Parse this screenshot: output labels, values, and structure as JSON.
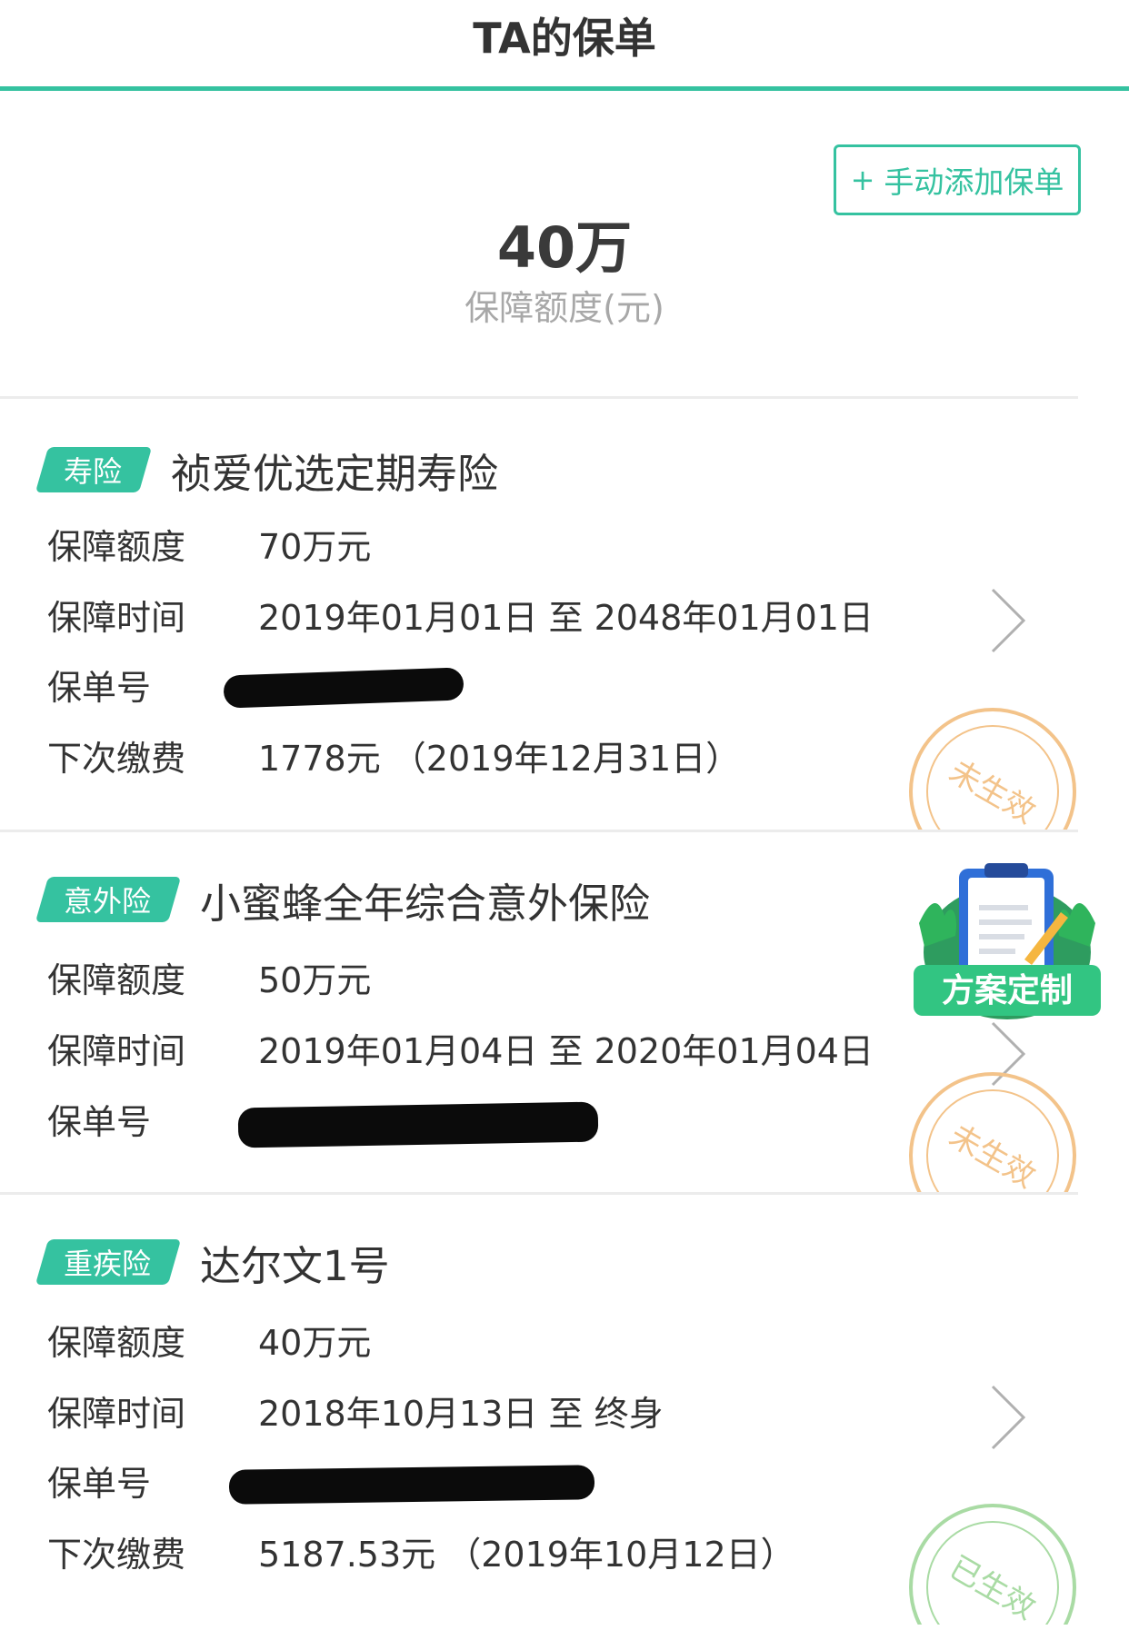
{
  "header": {
    "title": "TA的保单"
  },
  "add_button": {
    "plus": "+",
    "label": "手动添加保单"
  },
  "summary": {
    "amount": "40万",
    "label": "保障额度(元)"
  },
  "labels": {
    "coverage": "保障额度",
    "period": "保障时间",
    "policy_no": "保单号",
    "next_payment": "下次缴费"
  },
  "policies": [
    {
      "tag": "寿险",
      "name": "祯爱优选定期寿险",
      "coverage": "70万元",
      "period": "2019年01月01日 至 2048年01月01日",
      "next_payment": "1778元 （2019年12月31日）",
      "status": "未生效"
    },
    {
      "tag": "意外险",
      "name": "小蜜蜂全年综合意外保险",
      "coverage": "50万元",
      "period": "2019年01月04日 至 2020年01月04日",
      "status": "未生效"
    },
    {
      "tag": "重疾险",
      "name": "达尔文1号",
      "coverage": "40万元",
      "period": "2018年10月13日 至 终身",
      "next_payment": "5187.53元 （2019年10月12日）",
      "status": "已生效"
    }
  ],
  "float_badge": {
    "label": "方案定制"
  },
  "colors": {
    "accent": "#35c2a0",
    "stamp_pending": "#f3c38a",
    "stamp_active": "#a9dba4"
  },
  "icons": [
    "chevron-right-icon",
    "clipboard-icon",
    "stamp-icon"
  ]
}
